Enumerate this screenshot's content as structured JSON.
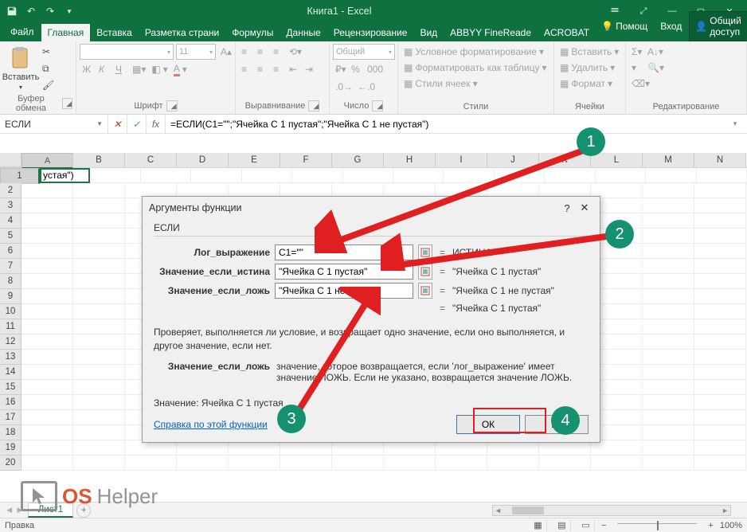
{
  "title": "Книга1 - Excel",
  "tabs": {
    "file": "Файл",
    "list": [
      "Главная",
      "Вставка",
      "Разметка страни",
      "Формулы",
      "Данные",
      "Рецензирование",
      "Вид",
      "ABBYY FineReade",
      "ACROBAT"
    ],
    "active_index": 0,
    "help": "Помощ",
    "signin": "Вход",
    "share": "Общий доступ"
  },
  "ribbon": {
    "clipboard": {
      "paste": "Вставить",
      "label": "Буфер обмена"
    },
    "font": {
      "label": "Шрифт",
      "size": "11"
    },
    "align": {
      "label": "Выравнивание"
    },
    "number": {
      "format": "Общий",
      "label": "Число"
    },
    "styles": {
      "cond": "Условное форматирование",
      "table": "Форматировать как таблицу",
      "cell": "Стили ячеек",
      "label": "Стили"
    },
    "cells": {
      "insert": "Вставить",
      "delete": "Удалить",
      "format": "Формат",
      "label": "Ячейки"
    },
    "editing": {
      "label": "Редактирование"
    }
  },
  "namebox": "ЕСЛИ",
  "formula": "=ЕСЛИ(C1=\"\";\"Ячейка С 1 пустая\";\"Ячейка С 1 не пустая\")",
  "columns": [
    "A",
    "B",
    "C",
    "D",
    "E",
    "F",
    "G",
    "H",
    "I",
    "J",
    "K",
    "L",
    "M",
    "N"
  ],
  "cellA1": "устая\")",
  "dialog": {
    "title": "Аргументы функции",
    "fn": "ЕСЛИ",
    "args": [
      {
        "label": "Лог_выражение",
        "value": "C1=\"\"",
        "result": "ИСТИНА"
      },
      {
        "label": "Значение_если_истина",
        "value": "\"Ячейка С 1 пустая\"",
        "result": "\"Ячейка С 1 пустая\""
      },
      {
        "label": "Значение_если_ложь",
        "value": "\"Ячейка С 1 не пустая\"",
        "result": "\"Ячейка С 1 не пустая\""
      }
    ],
    "overall": "\"Ячейка С 1 пустая\"",
    "desc": "Проверяет, выполняется ли условие, и возвращает одно значение, если оно выполняется, и другое значение, если нет.",
    "desc2_label": "Значение_если_ложь",
    "desc2_text": "значение, которое возвращается, если 'лог_выражение' имеет значение ЛОЖЬ. Если не указано, возвращается значение ЛОЖЬ.",
    "value_label": "Значение:",
    "value": "Ячейка С 1 пустая",
    "help": "Справка по этой функции",
    "ok": "ОК",
    "cancel": "на"
  },
  "sheet": "Лист1",
  "status": {
    "mode": "Правка",
    "zoom": "100%"
  },
  "anno": {
    "1": "1",
    "2": "2",
    "3": "3",
    "4": "4"
  }
}
